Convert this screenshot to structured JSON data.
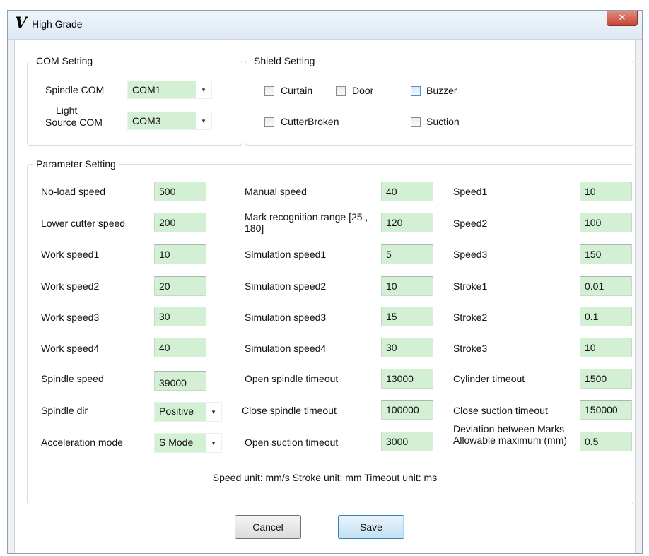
{
  "window": {
    "title": "High Grade",
    "close_glyph": "✕"
  },
  "com_setting": {
    "legend": "COM Setting",
    "spindle_label": "Spindle COM",
    "spindle_value": "COM1",
    "light_label_1": "Light",
    "light_label_2": "Source COM",
    "light_value": "COM3"
  },
  "shield_setting": {
    "legend": "Shield Setting",
    "items": [
      {
        "label": "Curtain",
        "checked": false
      },
      {
        "label": "Door",
        "checked": false
      },
      {
        "label": "Buzzer",
        "checked": false
      },
      {
        "label": "CutterBroken",
        "checked": false
      },
      {
        "label": "Suction",
        "checked": false
      }
    ]
  },
  "parameter_setting": {
    "legend": "Parameter Setting",
    "col1": [
      {
        "label": "No-load speed",
        "value": "500"
      },
      {
        "label": "Lower cutter speed",
        "value": "200"
      },
      {
        "label": "Work speed1",
        "value": "10"
      },
      {
        "label": "Work speed2",
        "value": "20"
      },
      {
        "label": "Work speed3",
        "value": "30"
      },
      {
        "label": "Work speed4",
        "value": "40"
      },
      {
        "label": "Spindle speed",
        "value": "39000"
      },
      {
        "label": "Spindle dir",
        "value": "Positive"
      },
      {
        "label": "Acceleration mode",
        "value": "S Mode"
      }
    ],
    "col2": [
      {
        "label": "Manual speed",
        "value": "40"
      },
      {
        "label": "Mark recognition range [25 , 180]",
        "value": "120"
      },
      {
        "label": "Simulation speed1",
        "value": "5"
      },
      {
        "label": "Simulation speed2",
        "value": "10"
      },
      {
        "label": "Simulation speed3",
        "value": "15"
      },
      {
        "label": "Simulation speed4",
        "value": "30"
      },
      {
        "label": "Open spindle timeout",
        "value": "13000"
      },
      {
        "label": "Close spindle timeout",
        "value": "100000"
      },
      {
        "label": "Open suction timeout",
        "value": "3000"
      }
    ],
    "col3": [
      {
        "label": "Speed1",
        "value": "10"
      },
      {
        "label": "Speed2",
        "value": "100"
      },
      {
        "label": "Speed3",
        "value": "150"
      },
      {
        "label": "Stroke1",
        "value": "0.01"
      },
      {
        "label": "Stroke2",
        "value": "0.1"
      },
      {
        "label": "Stroke3",
        "value": "10"
      },
      {
        "label": "Cylinder timeout",
        "value": "1500"
      },
      {
        "label": "Close suction timeout",
        "value": "150000"
      },
      {
        "label": "Deviation between Marks Allowable maximum (mm)",
        "value": "0.5"
      }
    ],
    "units_note": "Speed unit: mm/s Stroke unit: mm Timeout unit: ms"
  },
  "buttons": {
    "cancel": "Cancel",
    "save": "Save"
  },
  "icons": {
    "dropdown": "▾"
  },
  "colors": {
    "field_bg": "#d4f0d4",
    "close_red": "#c4463a"
  }
}
